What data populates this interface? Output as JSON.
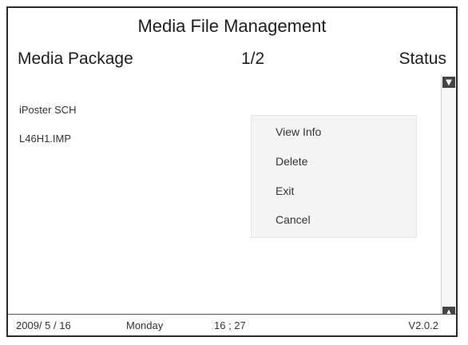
{
  "window": {
    "title": "Media File Management"
  },
  "header": {
    "left_label": "Media Package",
    "page_indicator": "1/2",
    "right_label": "Status"
  },
  "files": [
    {
      "name": "iPoster SCH"
    },
    {
      "name": "L46H1.IMP"
    }
  ],
  "context_menu": {
    "items": [
      "View Info",
      "Delete",
      "Exit",
      "Cancel"
    ]
  },
  "footer": {
    "date": "2009/ 5 / 16",
    "weekday": "Monday",
    "time": "16 ; 27",
    "version": "V2.0.2"
  },
  "scrollbar": {
    "up_arrow": "▼",
    "down_arrow": "▲"
  }
}
